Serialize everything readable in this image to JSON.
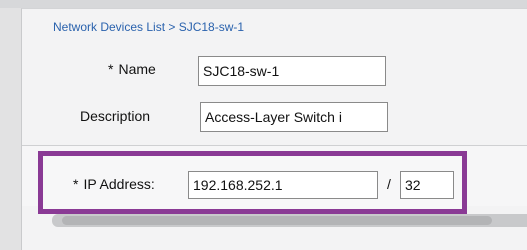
{
  "breadcrumb": "Network Devices List > SJC18-sw-1",
  "form": {
    "name": {
      "required_marker": "*",
      "label": "Name",
      "value": "SJC18-sw-1"
    },
    "description": {
      "label": "Description",
      "value": "Access-Layer Switch i"
    },
    "ip_address": {
      "required_marker": "*",
      "label": "IP Address:",
      "value": "192.168.252.1",
      "separator": "/",
      "mask": "32"
    }
  },
  "colors": {
    "highlight_border": "#8a3a95",
    "breadcrumb_link": "#2a62ad"
  }
}
